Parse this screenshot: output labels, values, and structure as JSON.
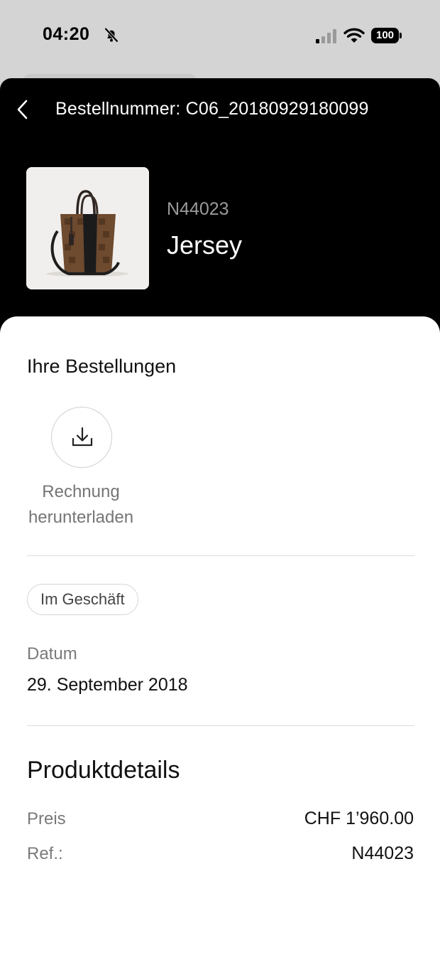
{
  "status_bar": {
    "time": "04:20",
    "battery": "100"
  },
  "header": {
    "order_title": "Bestellnummer: C06_20180929180099",
    "product_code": "N44023",
    "product_name": "Jersey"
  },
  "orders": {
    "section_title": "Ihre Bestellungen",
    "download_label_line1": "Rechnung",
    "download_label_line2": "herunterladen"
  },
  "purchase": {
    "channel": "Im Geschäft",
    "date_label": "Datum",
    "date_value": "29. September 2018"
  },
  "details": {
    "title": "Produktdetails",
    "price_label": "Preis",
    "price_value": "CHF 1’960.00",
    "ref_label": "Ref.:",
    "ref_value": "N44023"
  },
  "icons": {
    "back": "chevron-left-icon",
    "download": "download-icon",
    "bell_off": "bell-slash-icon",
    "signal": "cellular-signal-icon",
    "wifi": "wifi-icon",
    "battery": "battery-icon"
  }
}
